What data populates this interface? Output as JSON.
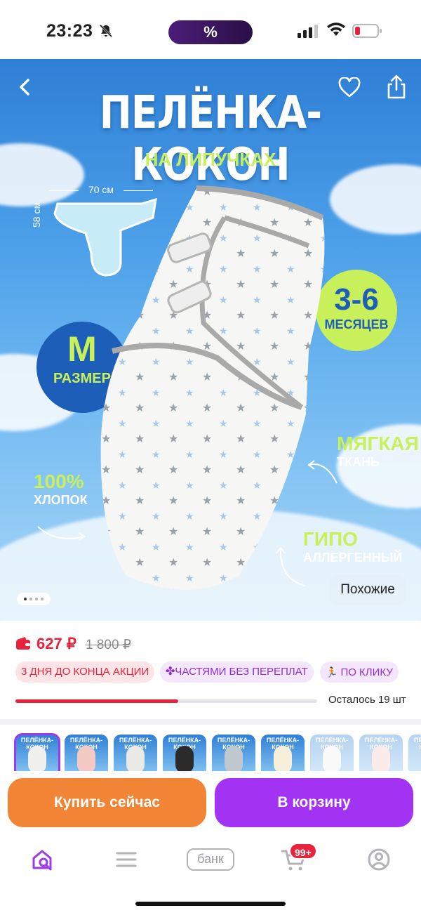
{
  "status_bar": {
    "time": "23:23",
    "promo": "%"
  },
  "hero": {
    "title": "ПЕЛЁНКА-КОКОН",
    "subtitle": "НА ЛИПУЧКАХ",
    "width_label": "70 см",
    "height_label": "58 см",
    "size_letter": "M",
    "size_word": "РАЗМЕР",
    "age_range": "3-6",
    "age_word": "МЕСЯЦЕВ",
    "feature_cotton_big": "100%",
    "feature_cotton_small": "ХЛОПОК",
    "feature_soft_big": "МЯГКАЯ",
    "feature_soft_small": "ТКАНЬ",
    "feature_hypo_big": "ГИПО",
    "feature_hypo_small": "АЛЛЕРГЕННЫЙ",
    "similar_label": "Похожие",
    "gallery_index": 1,
    "gallery_total": 4
  },
  "price": {
    "current": "627 ₽",
    "old": "1 800 ₽",
    "tags": [
      "3 ДНЯ ДО КОНЦА АКЦИИ",
      "ЧАСТЯМИ БЕЗ ПЕРЕПЛАТ",
      "ПО КЛИКУ"
    ],
    "stock_text": "Осталось 19 шт",
    "stock_progress": 0.54
  },
  "thumbnails": {
    "title": "ПЕЛЁНКА-КОКОН",
    "count": 9,
    "selected_index": 0
  },
  "actions": {
    "buy_now": "Купить сейчас",
    "add_to_cart": "В корзину"
  },
  "tabbar": {
    "bank_label": "банк",
    "cart_badge": "99+"
  },
  "colors": {
    "accent_purple": "#a233f3",
    "buy_orange": "#f28535",
    "price_red": "#e8243d"
  }
}
